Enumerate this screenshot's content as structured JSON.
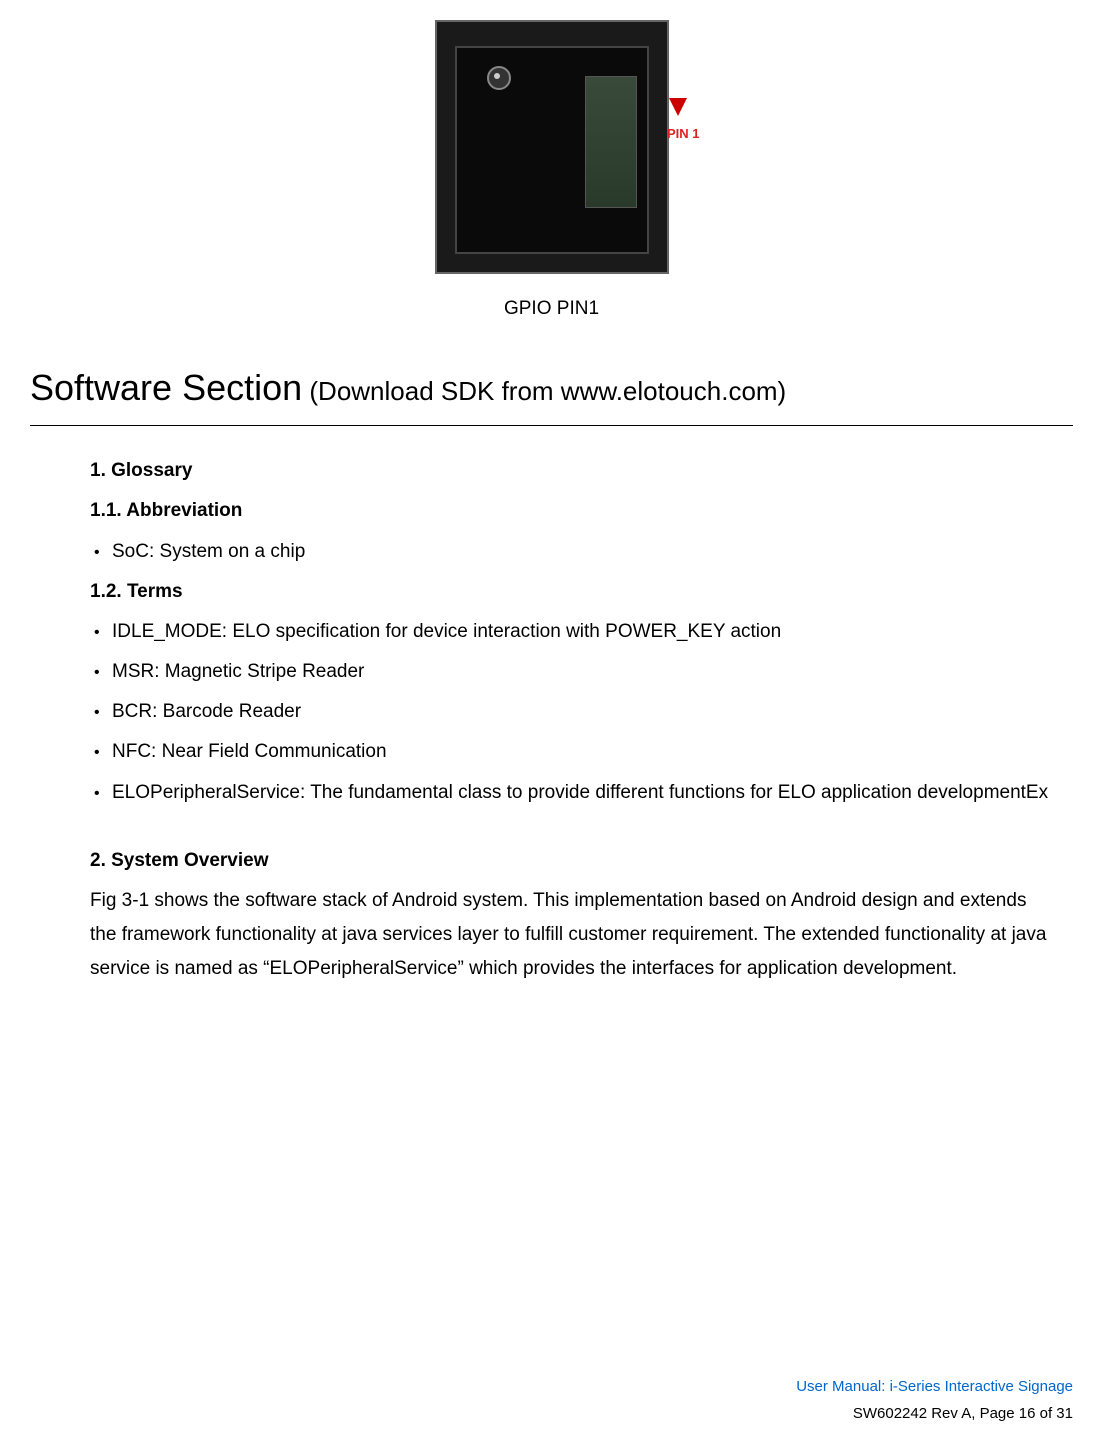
{
  "image": {
    "pin_label": "PIN 1",
    "caption": "GPIO PIN1"
  },
  "section_title_main": "Software Section",
  "section_title_sub": " (Download SDK from www.elotouch.com)",
  "glossary": {
    "heading": "1.  Glossary",
    "abbreviation_heading": "1.1.  Abbreviation",
    "abbreviation_items": [
      "SoC: System on a chip"
    ],
    "terms_heading": "1.2.  Terms",
    "terms_items": [
      "IDLE_MODE: ELO specification for device interaction with POWER_KEY action",
      "MSR: Magnetic Stripe Reader",
      "BCR: Barcode Reader",
      "NFC: Near Field Communication",
      "ELOPeripheralService: The fundamental class to provide different functions for ELO application developmentEx"
    ]
  },
  "system_overview": {
    "heading": "2.  System Overview",
    "paragraph": "Fig 3-1 shows the software stack of Android system. This implementation based on Android design and extends the framework functionality at java services layer to fulfill customer requirement. The extended functionality at java service is named as “ELOPeripheralService” which provides the interfaces for application development."
  },
  "footer": {
    "line1": "User Manual: i-Series Interactive Signage",
    "line2": "SW602242 Rev A, Page 16 of 31"
  }
}
